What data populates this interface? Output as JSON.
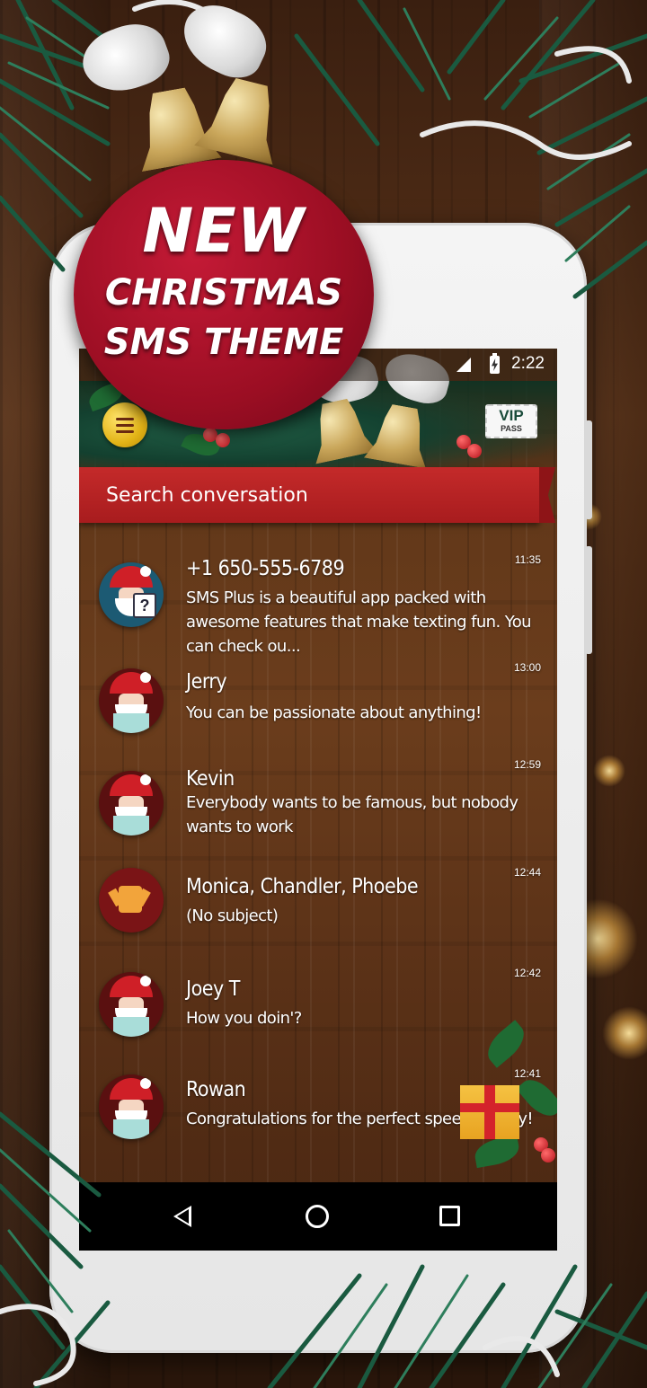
{
  "promo": {
    "line1": "NEW",
    "line2": "CHRISTMAS",
    "line3": "SMS THEME"
  },
  "status_bar": {
    "time": "2:22",
    "icons": [
      "signal-icon",
      "battery-charging-icon"
    ]
  },
  "header": {
    "menu_icon": "hamburger-menu-icon",
    "vip": "VIP",
    "pass": "PASS"
  },
  "search": {
    "placeholder": "Search conversation"
  },
  "conversations": [
    {
      "name": "+1 650-555-6789",
      "preview": "SMS Plus is a beautiful app packed with awesome features that make texting fun. You can check ou...",
      "time": "11:35",
      "avatar": "santa-unknown-contact-avatar"
    },
    {
      "name": "Jerry",
      "preview": " You can be passionate about anything!",
      "time": "13:00",
      "avatar": "santa-avatar"
    },
    {
      "name": "Kevin",
      "preview": " Everybody wants to be famous, but nobody wants to work",
      "time": "12:59",
      "avatar": "santa-avatar"
    },
    {
      "name": "Monica, Chandler, Phoebe",
      "preview": "(No subject)",
      "time": "12:44",
      "avatar": "group-fist-avatar"
    },
    {
      "name": "Joey T",
      "preview": "How you doin'?",
      "time": "12:42",
      "avatar": "santa-avatar"
    },
    {
      "name": "Rowan",
      "preview": "Congratulations for the perfect speech today!",
      "time": "12:41",
      "avatar": "santa-avatar"
    }
  ],
  "nav": {
    "icons": [
      "back-icon",
      "home-icon",
      "recents-icon"
    ]
  },
  "colors": {
    "promo_red": "#9b0e23",
    "search_red": "#c42a2a",
    "wood_brown": "#5b3418",
    "pine_green": "#1f6b4a",
    "menu_gold": "#e3b417"
  }
}
